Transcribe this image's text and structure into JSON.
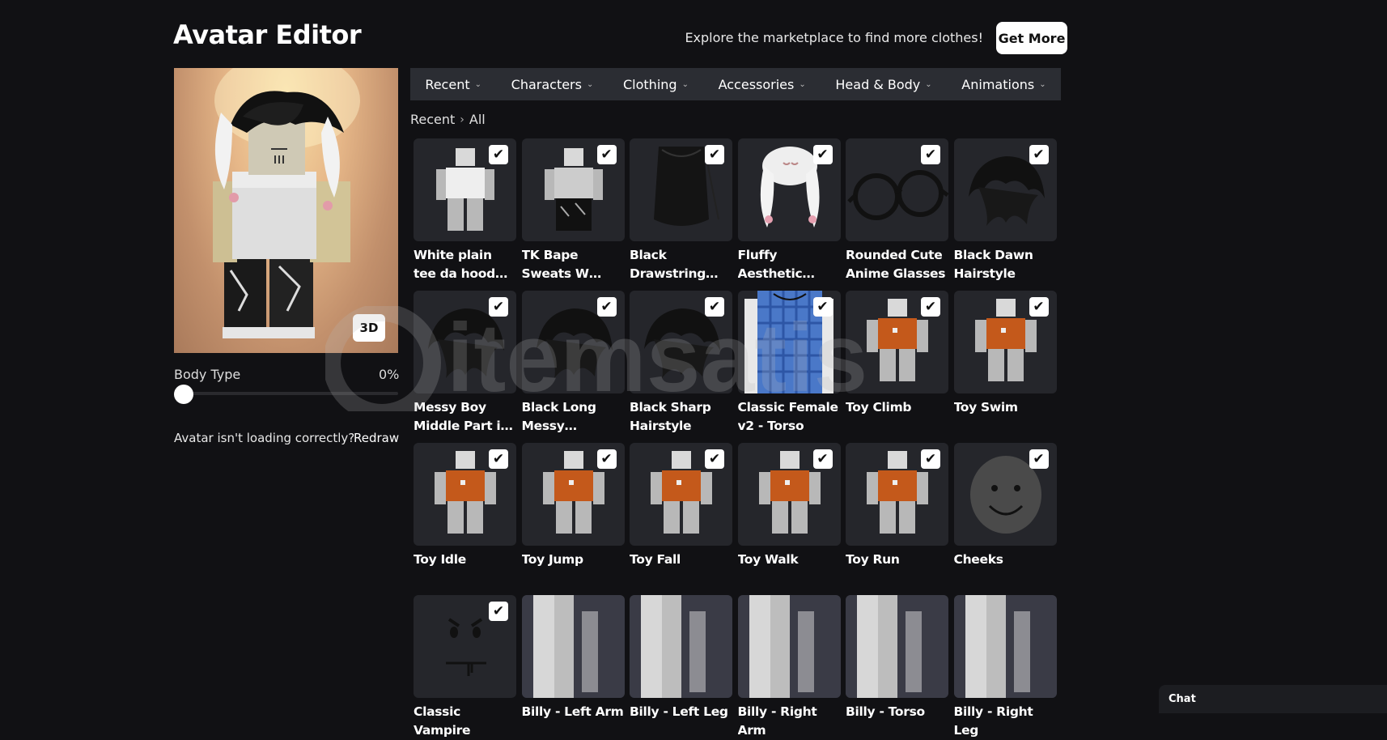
{
  "header": {
    "title": "Avatar Editor",
    "explore_text": "Explore the marketplace to find more clothes!",
    "get_more_label": "Get More"
  },
  "preview": {
    "view_toggle_label": "3D",
    "body_type_label": "Body Type",
    "body_type_value": "0%",
    "body_type_fraction": 0,
    "loading_text": "Avatar isn't loading correctly?",
    "redraw_label": "Redraw"
  },
  "tabs": [
    {
      "label": "Recent"
    },
    {
      "label": "Characters"
    },
    {
      "label": "Clothing"
    },
    {
      "label": "Accessories"
    },
    {
      "label": "Head & Body"
    },
    {
      "label": "Animations"
    }
  ],
  "breadcrumb": {
    "first": "Recent",
    "second": "All"
  },
  "items": [
    {
      "name": "White plain tee da hood slender",
      "checked": true,
      "icon": "tee-figure"
    },
    {
      "name": "TK Bape Sweats W Bapestas",
      "checked": true,
      "icon": "pants-figure"
    },
    {
      "name": "Black Drawstring Bag",
      "checked": true,
      "icon": "bag"
    },
    {
      "name": "Fluffy Aesthetic Bunny Hat",
      "checked": true,
      "icon": "bunny-hat"
    },
    {
      "name": "Rounded Cute Anime Glasses",
      "checked": true,
      "icon": "glasses"
    },
    {
      "name": "Black Dawn Hairstyle",
      "checked": true,
      "icon": "hair"
    },
    {
      "name": "Messy Boy Middle Part in Black",
      "checked": true,
      "icon": "hair"
    },
    {
      "name": "Black Long Messy Hairstyle",
      "checked": true,
      "icon": "hair"
    },
    {
      "name": "Black Sharp Hairstyle",
      "checked": true,
      "icon": "hair"
    },
    {
      "name": "Classic Female v2 - Torso",
      "checked": true,
      "icon": "torso-blue"
    },
    {
      "name": "Toy Climb",
      "checked": true,
      "icon": "toy"
    },
    {
      "name": "Toy Swim",
      "checked": true,
      "icon": "toy"
    },
    {
      "name": "Toy Idle",
      "checked": true,
      "icon": "toy"
    },
    {
      "name": "Toy Jump",
      "checked": true,
      "icon": "toy"
    },
    {
      "name": "Toy Fall",
      "checked": true,
      "icon": "toy"
    },
    {
      "name": "Toy Walk",
      "checked": true,
      "icon": "toy"
    },
    {
      "name": "Toy Run",
      "checked": true,
      "icon": "toy"
    },
    {
      "name": "Cheeks",
      "checked": true,
      "icon": "head"
    },
    {
      "name": "Classic Vampire",
      "checked": true,
      "icon": "face"
    },
    {
      "name": "Billy - Left Arm",
      "checked": false,
      "icon": "limb"
    },
    {
      "name": "Billy - Left Leg",
      "checked": false,
      "icon": "limb"
    },
    {
      "name": "Billy - Right Arm",
      "checked": false,
      "icon": "limb"
    },
    {
      "name": "Billy - Torso",
      "checked": false,
      "icon": "limb"
    },
    {
      "name": "Billy - Right Leg",
      "checked": false,
      "icon": "limb"
    }
  ],
  "chat": {
    "label": "Chat"
  },
  "colors": {
    "background": "#111114",
    "card": "#25262b",
    "tabbar": "#2b2d33",
    "accent": "#ffffff"
  }
}
